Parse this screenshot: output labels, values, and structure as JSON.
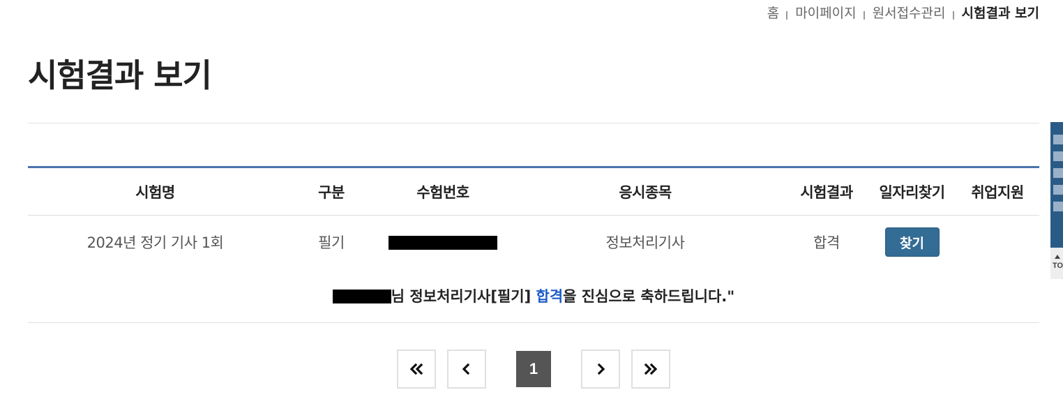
{
  "breadcrumb": {
    "items": [
      "홈",
      "마이페이지",
      "원서접수관리",
      "시험결과 보기"
    ]
  },
  "page": {
    "title": "시험결과 보기"
  },
  "results_table": {
    "headers": {
      "name": "시험명",
      "type": "구분",
      "number": "수험번호",
      "subject": "응시종목",
      "result": "시험결과",
      "job": "일자리찾기",
      "apply": "취업지원"
    },
    "rows": [
      {
        "name": "2024년 정기 기사 1회",
        "type": "필기",
        "number_redacted": true,
        "subject": "정보처리기사",
        "result": "합격",
        "job_button": "찾기",
        "apply": ""
      }
    ],
    "congrats": {
      "name_redacted": true,
      "before": "님 정보처리기사[필기] ",
      "highlight": "합격",
      "after": "을 진심으로 축하드립니다.\"",
      "highlight_color": "#1e5cc8"
    }
  },
  "pagination": {
    "first_icon": "double-chevron-left-icon",
    "prev_icon": "chevron-left-icon",
    "current_page": "1",
    "next_icon": "chevron-right-icon",
    "last_icon": "double-chevron-right-icon"
  },
  "side": {
    "top_label": "TO"
  },
  "colors": {
    "table_top_border": "#4a74ab",
    "find_button": "#336c94",
    "current_page": "#555555",
    "side_banner": "#2a5b86"
  }
}
